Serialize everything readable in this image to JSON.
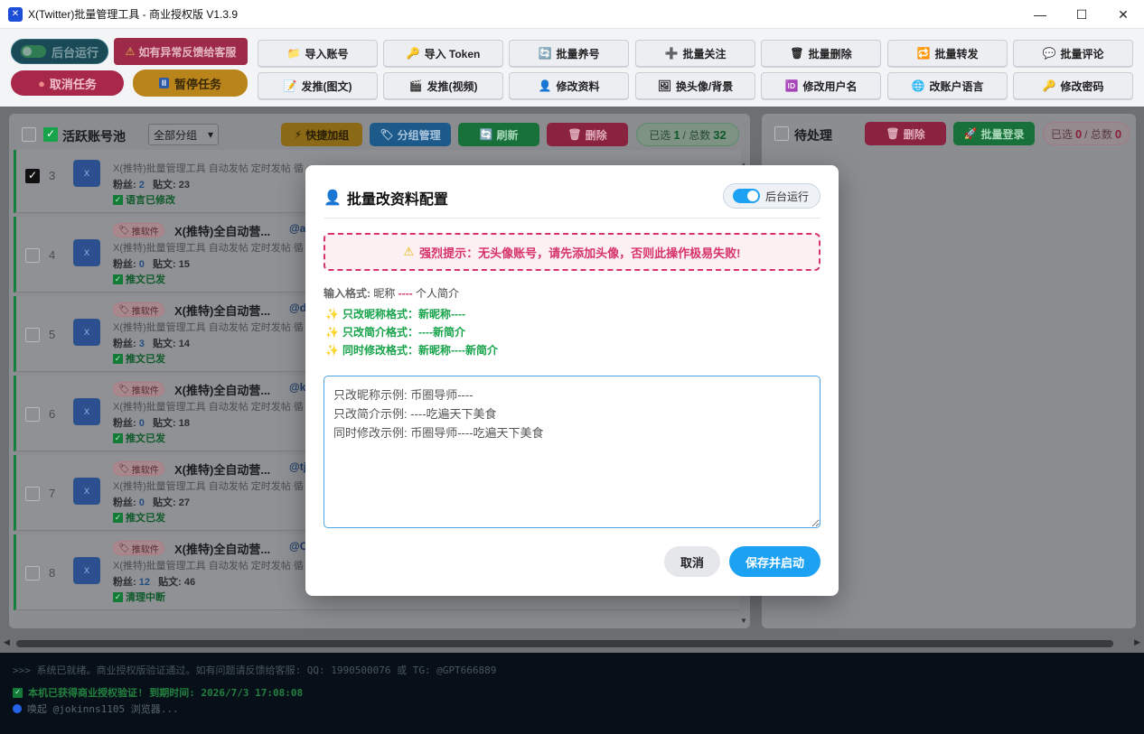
{
  "window": {
    "title": "X(Twitter)批量管理工具 - 商业授权版 V1.3.9"
  },
  "toolbar": {
    "bg_run": "后台运行",
    "feedback": "如有异常反馈给客服",
    "cancel_task": "取消任务",
    "pause_task": "暂停任务",
    "buttons_row1": [
      "导入账号",
      "导入 Token",
      "批量养号",
      "批量关注",
      "批量删除",
      "批量转发",
      "批量评论"
    ],
    "buttons_row2": [
      "发推(图文)",
      "发推(视频)",
      "修改资料",
      "换头像/背景",
      "修改用户名",
      "改账户语言",
      "修改密码"
    ]
  },
  "left": {
    "title": "活跃账号池",
    "group_select": "全部分组",
    "quick_group": "快捷加组",
    "group_manage": "分组管理",
    "refresh": "刷新",
    "delete": "删除",
    "selected_label": "已选",
    "selected": "1",
    "total_label": "/ 总数",
    "total": "32",
    "rows": [
      {
        "num": "3",
        "name": "",
        "handle": "",
        "bio": "X(推特)批量管理工具 自动发帖 定时发帖 循",
        "fans": "2",
        "posts": "23",
        "status": "语言已修改",
        "checked": true
      },
      {
        "num": "4",
        "tag": "推软件",
        "name": "X(推特)全自动营...",
        "handle": "@a",
        "bio": "X(推特)批量管理工具 自动发帖 定时发帖 循",
        "fans": "0",
        "posts": "15",
        "status": "推文已发"
      },
      {
        "num": "5",
        "tag": "推软件",
        "name": "X(推特)全自动营...",
        "handle": "@d",
        "bio": "X(推特)批量管理工具 自动发帖 定时发帖 循",
        "fans": "3",
        "posts": "14",
        "status": "推文已发"
      },
      {
        "num": "6",
        "tag": "推软件",
        "name": "X(推特)全自动营...",
        "handle": "@k",
        "bio": "X(推特)批量管理工具 自动发帖 定时发帖 循",
        "fans": "0",
        "posts": "18",
        "status": "推文已发"
      },
      {
        "num": "7",
        "tag": "推软件",
        "name": "X(推特)全自动营...",
        "handle": "@tj",
        "bio": "X(推特)批量管理工具 自动发帖 定时发帖 循",
        "fans": "0",
        "posts": "27",
        "status": "推文已发"
      },
      {
        "num": "8",
        "tag": "推软件",
        "name": "X(推特)全自动营...",
        "handle": "@C",
        "bio": "X(推特)批量管理工具 自动发帖 定时发帖 循",
        "fans": "12",
        "posts": "46",
        "status": "清理中断"
      }
    ],
    "fans_label": "粉丝:",
    "posts_label": "贴文:"
  },
  "right": {
    "title": "待处理",
    "delete": "删除",
    "batch_login": "批量登录",
    "selected_label": "已选",
    "selected": "0",
    "total_label": "/ 总数",
    "total": "0"
  },
  "log": {
    "line1": ">>> 系统已就绪。商业授权版验证通过。如有问题请反馈给客服: QQ: 1990500076 或 TG: @GPT666889",
    "line2": "本机已获得商业授权验证! 到期时间: 2026/7/3 17:08:08",
    "line3": "唤起 @jokinns1105 浏览器..."
  },
  "modal": {
    "title": "批量改资料配置",
    "bg_run": "后台运行",
    "warning": "强烈提示：无头像账号，请先添加头像，否则此操作极易失败!",
    "format_label": "输入格式:",
    "format_nick": "昵称",
    "format_sep": "----",
    "format_bio": "个人简介",
    "examples": [
      "只改昵称格式：新昵称----",
      "只改简介格式：----新简介",
      "同时修改格式：新昵称----新简介"
    ],
    "textarea_placeholder": "只改昵称示例: 币圈导师----\n只改简介示例: ----吃遍天下美食\n同时修改示例: 币圈导师----吃遍天下美食",
    "cancel": "取消",
    "save": "保存并启动"
  }
}
